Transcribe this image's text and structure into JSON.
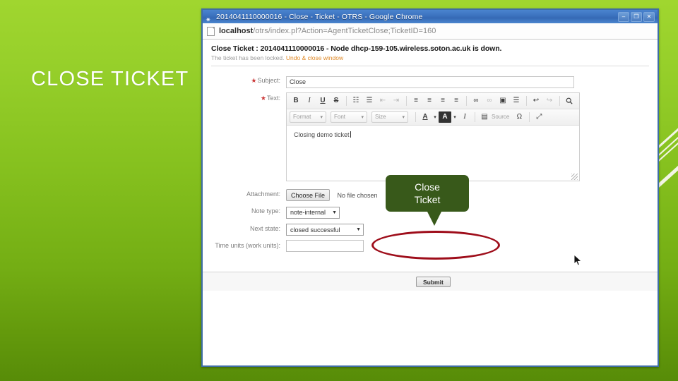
{
  "slide": {
    "title": "CLOSE TICKET",
    "background_top": "#a0d62f",
    "background_bottom": "#578c08"
  },
  "browser": {
    "window_title": "2014041110000016 - Close - Ticket - OTRS - Google Chrome",
    "url_host": "localhost",
    "url_path": "/otrs/index.pl?Action=AgentTicketClose;TicketID=160",
    "controls": {
      "minimize": "–",
      "maximize": "❐",
      "close": "✕"
    }
  },
  "page": {
    "heading": "Close Ticket : 2014041110000016 - Node dhcp-159-105.wireless.soton.ac.uk is down.",
    "sub_text": "The ticket has been locked.",
    "sub_link": "Undo & close window"
  },
  "form": {
    "subject": {
      "label": "Subject:",
      "required": true,
      "value": "Close"
    },
    "text": {
      "label": "Text:",
      "required": true,
      "body": "Closing demo ticket"
    },
    "attachment": {
      "label": "Attachment:",
      "button": "Choose File",
      "status": "No file chosen"
    },
    "note_type": {
      "label": "Note type:",
      "value": "note-internal"
    },
    "next_state": {
      "label": "Next state:",
      "value": "closed successful"
    },
    "time_units": {
      "label": "Time units (work units):",
      "value": ""
    },
    "submit": "Submit"
  },
  "editor_toolbar": {
    "row1": [
      {
        "name": "bold-icon",
        "glyph": "B"
      },
      {
        "name": "italic-icon",
        "glyph": "I"
      },
      {
        "name": "underline-icon",
        "glyph": "U"
      },
      {
        "name": "strikethrough-icon",
        "glyph": "S"
      },
      {
        "name": "bulleted-list-icon",
        "glyph": "☷"
      },
      {
        "name": "numbered-list-icon",
        "glyph": "☰"
      },
      {
        "name": "decrease-indent-icon",
        "glyph": "⇤"
      },
      {
        "name": "increase-indent-icon",
        "glyph": "⇥"
      },
      {
        "name": "align-left-icon",
        "glyph": "≡"
      },
      {
        "name": "align-center-icon",
        "glyph": "≡"
      },
      {
        "name": "align-right-icon",
        "glyph": "≡"
      },
      {
        "name": "justify-icon",
        "glyph": "≡"
      },
      {
        "name": "link-icon",
        "glyph": "∞"
      },
      {
        "name": "unlink-icon",
        "glyph": "∞"
      },
      {
        "name": "image-icon",
        "glyph": "▣"
      },
      {
        "name": "horizontal-rule-icon",
        "glyph": "☰"
      },
      {
        "name": "undo-icon",
        "glyph": "↩"
      },
      {
        "name": "redo-icon",
        "glyph": "↪"
      },
      {
        "name": "spellcheck-icon",
        "glyph": "🔍"
      }
    ],
    "row2": {
      "format_label": "Format",
      "font_label": "Font",
      "size_label": "Size",
      "text_color_icon": "A",
      "bg_color_icon": "A",
      "remove_format_icon": "I",
      "source_label": "Source",
      "special_char_icon": "Ω",
      "maximize_icon": "⤢"
    }
  },
  "annotation": {
    "callout_line1": "Close",
    "callout_line2": "Ticket",
    "callout_color": "#38591a",
    "ellipse_color": "#9e0d1a"
  }
}
